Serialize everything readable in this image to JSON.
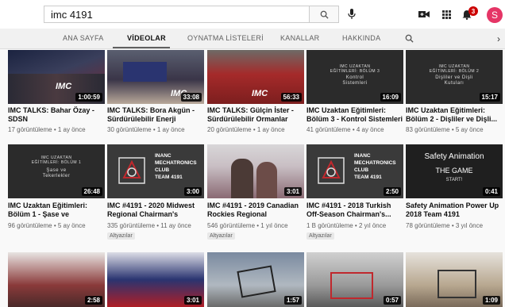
{
  "search": {
    "query": "imc 4191"
  },
  "header": {
    "notification_count": "3",
    "avatar_letter": "S"
  },
  "tabs": [
    "ANA SAYFA",
    "VİDEOLAR",
    "OYNATMA LİSTELERİ",
    "KANALLAR",
    "HAKKINDA"
  ],
  "colors": {
    "accent_red": "#cc0000",
    "avatar": "#e53566",
    "brand_red": "#c0282d"
  },
  "videos": [
    {
      "title": "IMC TALKS: Bahar Özay - SDSN",
      "meta": "17 görüntüleme • 1 ay önce",
      "duration": "1:00:59",
      "thumb_text": "IMC"
    },
    {
      "title": "IMC TALKS: Bora Akgün - Sürdürülebilir Enerji",
      "meta": "30 görüntüleme • 1 ay önce",
      "duration": "33:08",
      "thumb_text": "IMC"
    },
    {
      "title": "IMC TALKS: Gülçin İster - Sürdürülebilir Ormanlar",
      "meta": "20 görüntüleme • 1 ay önce",
      "duration": "56:33",
      "thumb_text": "IMC"
    },
    {
      "title": "IMC Uzaktan Eğitimleri: Bölüm 3 - Kontrol Sistemleri",
      "meta": "41 görüntüleme • 4 ay önce",
      "duration": "16:09",
      "thumb_line1": "IMC UZAKTAN",
      "thumb_line2": "EĞİTİMLERİ: BÖLÜM 3",
      "thumb_line3": "Kontrol",
      "thumb_line4": "Sistemleri"
    },
    {
      "title": "IMC Uzaktan Eğitimleri: Bölüm 2 - Dişliler ve Dişli...",
      "meta": "83 görüntüleme • 5 ay önce",
      "duration": "15:17",
      "thumb_line1": "IMC UZAKTAN",
      "thumb_line2": "EĞİTİMLERİ: BÖLÜM 2",
      "thumb_line3": "Dişliler ve Dişli",
      "thumb_line4": "Kutuları"
    },
    {
      "title": "IMC Uzaktan Eğitimleri: Bölüm 1 - Şase ve Tekerlekler",
      "meta": "96 görüntüleme • 5 ay önce",
      "duration": "26:48",
      "thumb_line1": "IMC UZAKTAN",
      "thumb_line2": "EĞİTİMLERİ: BÖLÜM 1",
      "thumb_line3": "Şase ve",
      "thumb_line4": "Tekerlekler"
    },
    {
      "title": "IMC #4191 - 2020 Midwest Regional Chairman's Award...",
      "meta": "335 görüntüleme • 11 ay önce",
      "duration": "3:00",
      "badge": "Altyazılar",
      "thumb_lines": [
        "INANC",
        "MECHATRONICS",
        "CLUB",
        "TEAM 4191"
      ]
    },
    {
      "title": "IMC #4191 - 2019 Canadian Rockies Regional Chairman'...",
      "meta": "546 görüntüleme • 1 yıl önce",
      "duration": "3:01",
      "badge": "Altyazılar"
    },
    {
      "title": "IMC #4191 - 2018 Turkish Off-Season Chairman's...",
      "meta": "1 B görüntüleme • 2 yıl önce",
      "duration": "2:50",
      "badge": "Altyazılar",
      "thumb_lines": [
        "INANC",
        "MECHATRONICS",
        "CLUB",
        "TEAM 4191"
      ]
    },
    {
      "title": "Safety Animation Power Up 2018 Team 4191",
      "meta": "78 görüntüleme • 3 yıl önce",
      "duration": "0:41",
      "thumb_line1": "Safety Animation",
      "thumb_line2": "THE GAME",
      "thumb_line3": "START!"
    },
    {
      "duration": "2:58"
    },
    {
      "duration": "3:01"
    },
    {
      "duration": "1:57"
    },
    {
      "duration": "0:57"
    },
    {
      "duration": "1:09"
    }
  ]
}
